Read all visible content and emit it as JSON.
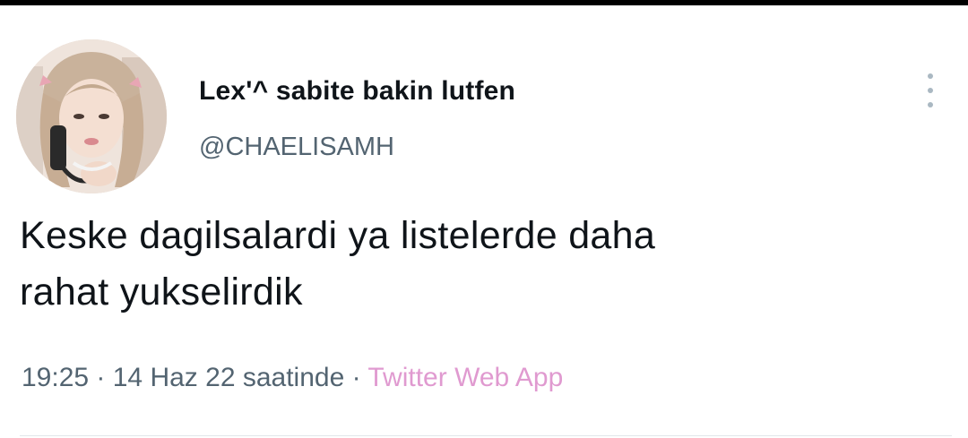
{
  "tweet": {
    "author": {
      "display_name": "Lex'^ sabite bakin lutfen",
      "handle": "@CHAELISAMH"
    },
    "text_lines": [
      "Keske dagilsalardi ya listelerde daha",
      "rahat yukselirdik"
    ],
    "time": "19:25",
    "separator": " · ",
    "date": "14 Haz 22 saatinde",
    "source": "Twitter Web App"
  },
  "icons": {
    "more": "more-vertical-icon"
  },
  "colors": {
    "text": "#0f1419",
    "secondary_text": "#536471",
    "source_link": "#e09ad0",
    "divider": "#e1e6ea"
  }
}
